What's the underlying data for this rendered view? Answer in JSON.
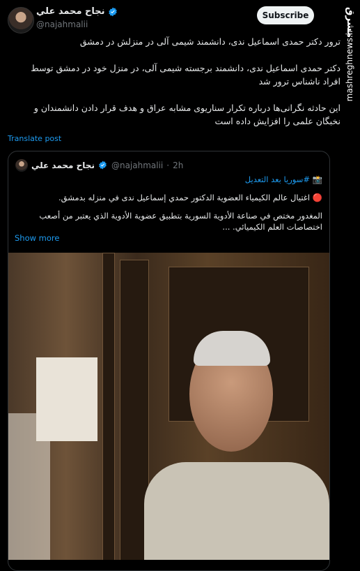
{
  "tweet": {
    "author_name": "نجاح محمد علي",
    "author_handle": "@najahmalii",
    "subscribe_label": "Subscribe",
    "paragraphs": [
      "ترور دکتر حمدی اسماعیل ندی، دانشمند شیمی آلی در منزلش در دمشق",
      "دکتر حمدی اسماعیل ندی، دانشمند برجسته شیمی آلی، در منزل خود در دمشق توسط افراد ناشناس ترور شد",
      "این حادثه نگرانی‌ها درباره تکرار سناریوی مشابه عراق و هدف قرار دادن دانشمندان و نخبگان علمی را افزایش داده است"
    ],
    "translate_label": "Translate post"
  },
  "quoted": {
    "author_name": "نجاح محمد علي",
    "author_handle": "@najahmalii",
    "time": "2h",
    "line1": "📸 #سوريا بعد التعديل",
    "line2": "🔴 اغتيال عالم الكيمياء العضوية الدكتور حمدي إسماعيل ندى في منزله بدمشق.",
    "line3": "المغدور مختص في صناعة الأدوية السورية بتطبيق عضوية الأدوية الذي يعتبر من أصعب اختصاصات العلم الكيميائي. ...",
    "show_more_label": "Show more"
  },
  "watermark": {
    "logo": "مشرق",
    "url": "mashreghnews.ir"
  },
  "colors": {
    "background": "#000000",
    "text": "#e7e9ea",
    "muted": "#71767b",
    "link": "#1d9bf0",
    "verified": "#1d9bf0",
    "subscribe_bg": "#eff3f4"
  },
  "icons": {
    "verified": "verified-badge-icon"
  }
}
